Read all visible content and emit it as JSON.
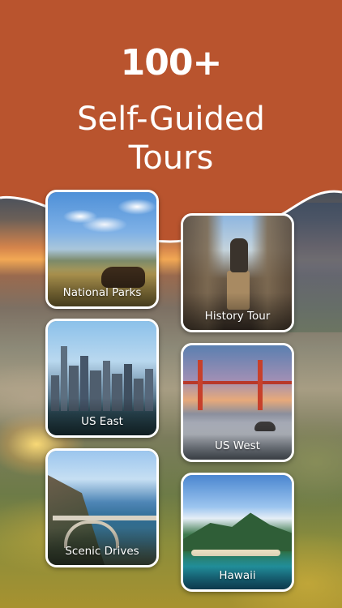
{
  "header": {
    "count": "100+",
    "title_line1": "Self-Guided",
    "title_line2": "Tours",
    "background_color": "#b9542e"
  },
  "cards": [
    {
      "label": "National Parks"
    },
    {
      "label": "History Tour"
    },
    {
      "label": "US East"
    },
    {
      "label": "US West"
    },
    {
      "label": "Scenic Drives"
    },
    {
      "label": "Hawaii"
    }
  ]
}
